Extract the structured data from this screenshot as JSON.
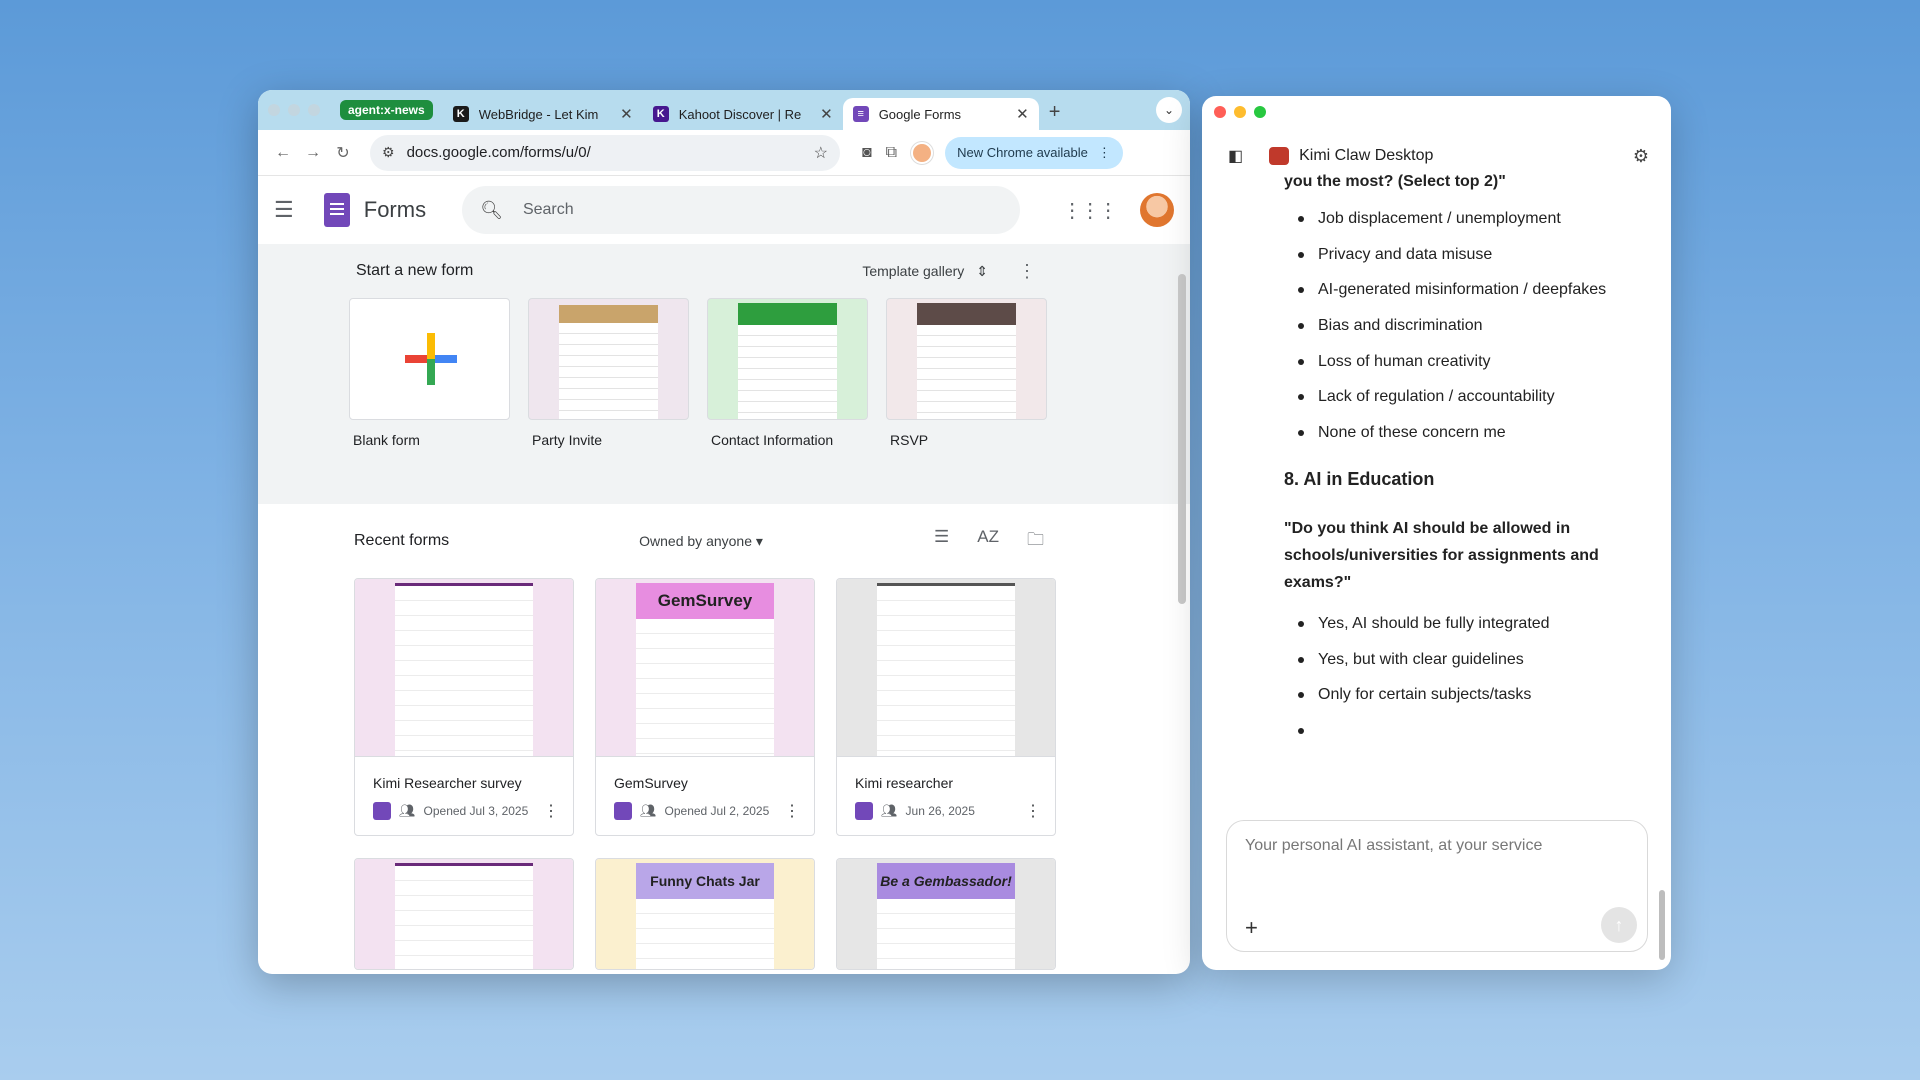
{
  "chrome": {
    "tab_group": "agent:x-news",
    "tabs": [
      {
        "title": "WebBridge - Let Kim",
        "favicon": "kimi-k-icon",
        "color": "#1a1a1a"
      },
      {
        "title": "Kahoot Discover | Re",
        "favicon": "kahoot-k-icon",
        "color": "#46178f"
      },
      {
        "title": "Google Forms",
        "favicon": "google-forms-icon",
        "color": "#7248b9",
        "active": true
      }
    ],
    "url": "docs.google.com/forms/u/0/",
    "update_label": "New Chrome available"
  },
  "forms": {
    "app_name": "Forms",
    "search_placeholder": "Search",
    "start_title": "Start a new form",
    "template_gallery": "Template gallery",
    "templates": [
      {
        "label": "Blank form"
      },
      {
        "label": "Party Invite"
      },
      {
        "label": "Contact Information"
      },
      {
        "label": "RSVP"
      }
    ],
    "recent_title": "Recent forms",
    "owned_filter": "Owned by anyone",
    "recent": [
      {
        "name": "Kimi Researcher survey",
        "date": "Opened Jul 3, 2025"
      },
      {
        "name": "GemSurvey",
        "date": "Opened Jul 2, 2025",
        "banner": "GemSurvey"
      },
      {
        "name": "Kimi researcher",
        "date": "Jun 26, 2025"
      }
    ],
    "partial_banners": [
      "",
      "Funny Chats Jar",
      "Be a Gembassador!"
    ]
  },
  "kimi": {
    "title": "Kimi Claw Desktop",
    "question_tail": "you the most? (Select top 2)\"",
    "concerns": [
      "Job displacement / unemployment",
      "Privacy and data misuse",
      "AI-generated misinformation / deepfakes",
      "Bias and discrimination",
      "Loss of human creativity",
      "Lack of regulation / accountability",
      "None of these concern me"
    ],
    "section_heading": "8. AI in Education",
    "education_question": "\"Do you think AI should be allowed in schools/universities for assignments and exams?\"",
    "education_options": [
      "Yes, AI should be fully integrated",
      "Yes, but with clear guidelines",
      "Only for certain subjects/tasks",
      ""
    ],
    "composer_placeholder": "Your personal AI assistant, at your service"
  },
  "colors": {
    "forms_purple": "#7248b9",
    "group_green": "#1e8e3e",
    "tab_strip": "#b7dcee"
  }
}
